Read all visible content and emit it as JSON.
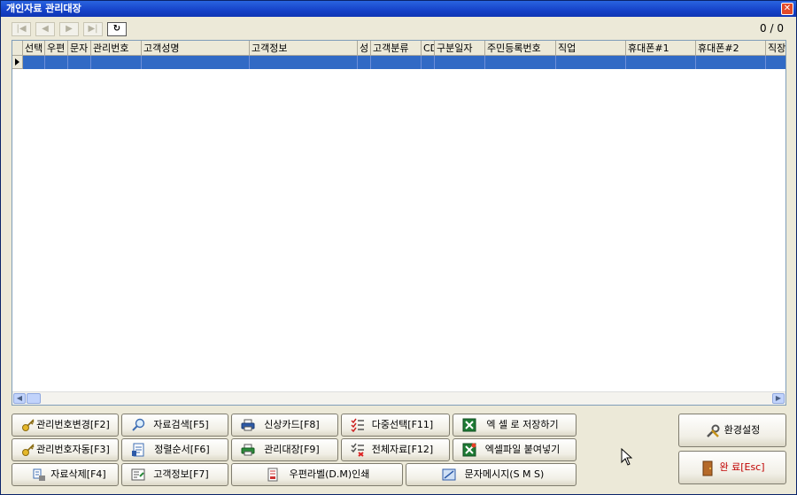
{
  "window": {
    "title": "개인자료 관리대장",
    "close_glyph": "✕"
  },
  "toolbar": {
    "nav": [
      "|◀",
      "◀",
      "▶",
      "▶|",
      "↻"
    ],
    "counter": "0 / 0"
  },
  "grid": {
    "columns": [
      "선택",
      "우편",
      "문자",
      "관리번호",
      "고객성명",
      "고객정보",
      "성",
      "고객분류",
      "CD",
      "구분일자",
      "주민등록번호",
      "직업",
      "휴대폰#1",
      "휴대폰#2",
      "직장"
    ]
  },
  "buttons": {
    "mgmt_change": "관리번호변경[F2]",
    "data_search": "자료검색[F5]",
    "new_card": "신상카드[F8]",
    "multi_select": "다중선택[F11]",
    "excel_save": "엑 셀 로 저장하기",
    "mgmt_auto": "관리번호자동[F3]",
    "sort_order": "정렬순서[F6]",
    "mgmt_ledger": "관리대장[F9]",
    "all_data": "전체자료[F12]",
    "excel_paste": "엑셀파일 붙여넣기",
    "data_delete": "자료삭제[F4]",
    "customer_info": "고객정보[F7]",
    "postal_label": "우편라벨(D.M)인쇄",
    "sms": "문자메시지(S M S)",
    "settings": "환경설정",
    "done": "완 료[Esc]"
  },
  "colors": {
    "title_bar": "#1542c8",
    "selected_row": "#316ac5",
    "done_text": "#c00000"
  }
}
